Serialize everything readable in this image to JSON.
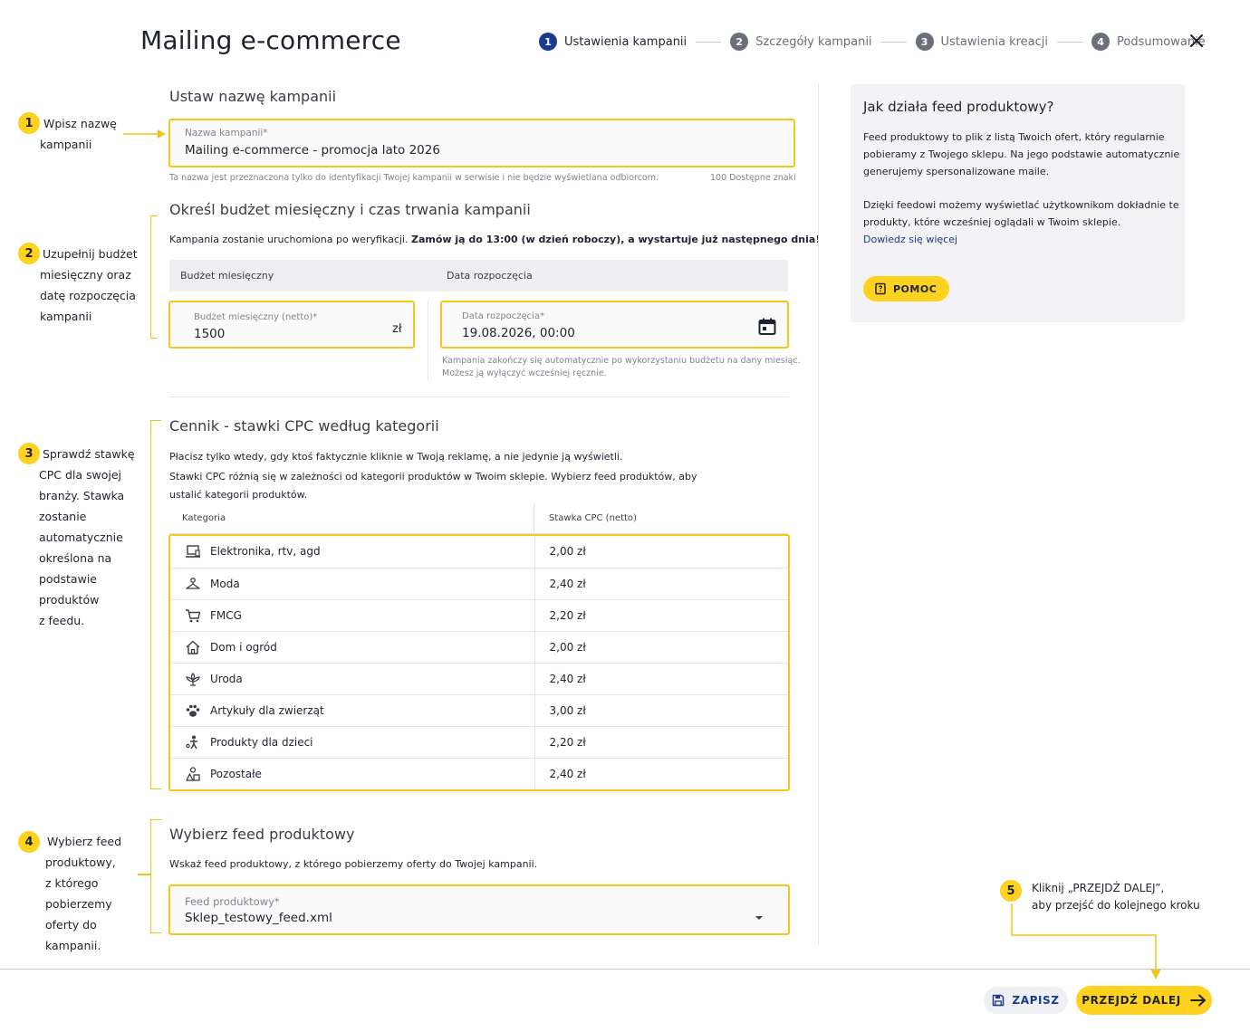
{
  "header": {
    "title": "Mailing e-commerce",
    "steps": [
      {
        "num": "1",
        "label": "Ustawienia kampanii"
      },
      {
        "num": "2",
        "label": "Szczegóły kampanii"
      },
      {
        "num": "3",
        "label": "Ustawienia kreacji"
      },
      {
        "num": "4",
        "label": "Podsumowanie"
      }
    ],
    "active_step": 1,
    "close_icon": "close-icon"
  },
  "annotations": [
    {
      "num": "1",
      "lines": [
        "Wpisz nazwę",
        "kampanii"
      ]
    },
    {
      "num": "2",
      "lines": [
        "Uzupełnij budżet",
        "miesięczny oraz",
        "datę rozpoczęcia",
        "kampanii"
      ]
    },
    {
      "num": "3",
      "lines": [
        "Sprawdź stawkę",
        "CPC dla swojej",
        "branży. Stawka",
        "zostanie",
        "automatycznie",
        "określona na",
        "podstawie",
        "produktów",
        "z feedu."
      ]
    },
    {
      "num": "4",
      "lines": [
        "Wybierz feed",
        "produktowy,",
        "z którego",
        "pobierzemy",
        "oferty do",
        "kampanii."
      ]
    },
    {
      "num": "5",
      "lines": [
        "Kliknij „PRZEJDŹ DALEJ”,",
        "aby przejść do kolejnego kroku"
      ]
    }
  ],
  "name_section": {
    "heading": "Ustaw nazwę kampanii",
    "field_label": "Nazwa kampanii*",
    "field_value": "Mailing e-commerce - promocja lato 2026",
    "helper": "Ta nazwa jest przeznaczona tylko do identyfikacji Twojej kampanii w serwisie i nie będzie wyświetlana odbiorcom.",
    "counter": "100 Dostępne znaki"
  },
  "budget_section": {
    "heading": "Określ budżet miesięczny i czas trwania kampanii",
    "notice_plain": "Kampania zostanie uruchomiona po weryfikacji.",
    "notice_bold": "Zamów ją do 13:00 (w dzień roboczy), a wystartuje już następnego dnia!",
    "col_budget": "Budżet miesięczny",
    "col_date": "Data rozpoczęcia",
    "budget_label": "Budżet miesięczny (netto)*",
    "budget_value": "1500",
    "budget_unit": "zł",
    "date_label": "Data rozpoczęcia*",
    "date_value": "19.08.2026, 00:00",
    "date_icon": "calendar-icon",
    "date_helper_1": "Kampania zakończy się automatycznie po wykorzystaniu budżetu na dany miesiąc.",
    "date_helper_2": "Możesz ją wyłączyć wcześniej ręcznie."
  },
  "cpc_section": {
    "heading": "Cennik - stawki CPC według kategorii",
    "desc_1": "Płacisz tylko wtedy, gdy ktoś faktycznie kliknie w Twoją reklamę, a nie jedynie ją wyświetli.",
    "desc_2": "Stawki CPC różnią się w zależności od kategorii produktów w Twoim sklepie. Wybierz feed produktów, aby",
    "desc_3": "ustalić kategorii produktów.",
    "col_category": "Kategoria",
    "col_rate": "Stawka CPC (netto)",
    "rows": [
      {
        "icon": "laptop-icon",
        "category": "Elektronika, rtv, agd",
        "rate": "2,00 zł"
      },
      {
        "icon": "hanger-icon",
        "category": "Moda",
        "rate": "2,40 zł"
      },
      {
        "icon": "cart-icon",
        "category": "FMCG",
        "rate": "2,20 zł"
      },
      {
        "icon": "home-icon",
        "category": "Dom i ogród",
        "rate": "2,00 zł"
      },
      {
        "icon": "lotus-icon",
        "category": "Uroda",
        "rate": "2,40 zł"
      },
      {
        "icon": "paw-icon",
        "category": "Artykuły dla zwierząt",
        "rate": "3,00 zł"
      },
      {
        "icon": "child-icon",
        "category": "Produkty dla dzieci",
        "rate": "2,20 zł"
      },
      {
        "icon": "shapes-icon",
        "category": "Pozostałe",
        "rate": "2,40 zł"
      }
    ]
  },
  "feed_section": {
    "heading": "Wybierz feed produktowy",
    "desc": "Wskaż feed produktowy, z którego pobierzemy oferty do Twojej kampanii.",
    "field_label": "Feed produktowy*",
    "field_value": "Sklep_testowy_feed.xml",
    "dropdown_icon": "caret-down-icon"
  },
  "info_panel": {
    "title": "Jak działa feed produktowy?",
    "para_1": [
      "Feed produktowy to plik z listą Twoich ofert, który regularnie",
      "pobieramy z Twojego sklepu. Na jego podstawie automatycznie",
      "generujemy spersonalizowane maile."
    ],
    "para_2": [
      "Dzięki feedowi możemy wyświetlać użytkownikom dokładnie te",
      "produkty, które wcześniej oglądali w Twoim sklepie."
    ],
    "link": "Dowiedz się więcej",
    "help_button": "POMOC"
  },
  "footer": {
    "save_label": "ZAPISZ",
    "next_label": "PRZEJDŹ DALEJ"
  },
  "colors": {
    "accent_yellow": "#ffd21f",
    "outline_yellow": "#f5c71a",
    "primary_blue": "#1b3a8c",
    "panel_gray": "#f3f3f5"
  }
}
